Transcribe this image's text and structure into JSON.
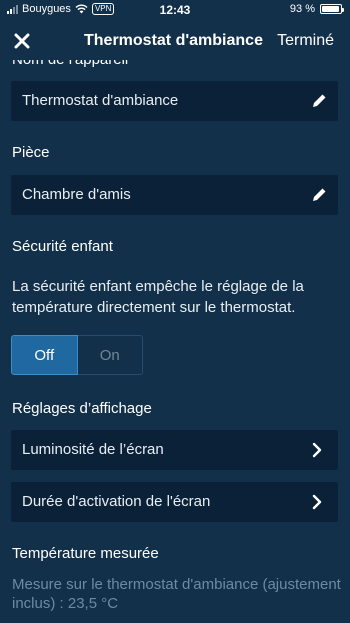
{
  "status_bar": {
    "carrier": "Bouygues",
    "vpn": "VPN",
    "time": "12:43",
    "battery": "93 %",
    "battery_level": 0.93
  },
  "nav": {
    "title": "Thermostat d'ambiance",
    "done": "Terminé"
  },
  "device_name": {
    "label": "Nom de l'appareil",
    "value": "Thermostat d'ambiance"
  },
  "room": {
    "label": "Pièce",
    "value": "Chambre d'amis"
  },
  "child_lock": {
    "label": "Sécurité enfant",
    "description": "La sécurité enfant empêche le réglage de la température directement sur le thermostat.",
    "options": [
      "Off",
      "On"
    ],
    "selected": "Off"
  },
  "display_settings": {
    "label": "Réglages d’affichage",
    "items": [
      {
        "label": "Luminosité de l’écran"
      },
      {
        "label": "Durée d'activation de l'écran"
      }
    ]
  },
  "measured_temp": {
    "label": "Température mesurée",
    "text": "Mesure sur le thermostat d'ambiance (ajustement inclus) : 23,5 °C"
  },
  "colors": {
    "background": "#123049",
    "field": "#0a2137",
    "accent": "#1f69a0",
    "muted_text": "#6c8aa5"
  },
  "icons": [
    "wifi-icon",
    "close-icon",
    "pencil-icon",
    "chevron-right-icon"
  ]
}
